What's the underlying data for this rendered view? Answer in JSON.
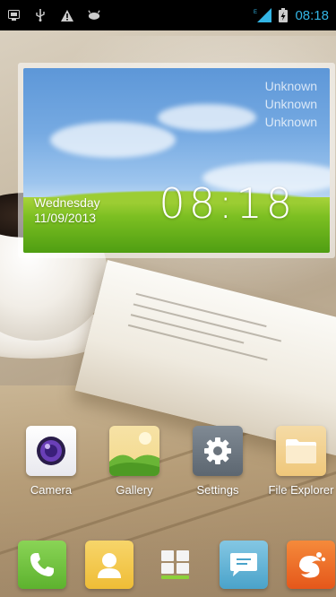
{
  "status_bar": {
    "left_icons": [
      "screenshot-icon",
      "usb-icon",
      "warning-icon",
      "debug-icon"
    ],
    "network_type": "E",
    "right_icons": [
      "signal-icon",
      "battery-charging-icon"
    ],
    "time": "08:18"
  },
  "widget": {
    "weather_lines": [
      "Unknown",
      "Unknown",
      "Unknown"
    ],
    "day": "Wednesday",
    "date": "11/09/2013",
    "time": "08:18"
  },
  "apps": [
    {
      "label": "Camera",
      "icon": "camera-icon"
    },
    {
      "label": "Gallery",
      "icon": "gallery-icon"
    },
    {
      "label": "Settings",
      "icon": "settings-gear-icon"
    },
    {
      "label": "File Explorer",
      "icon": "folder-icon"
    }
  ],
  "dock": [
    {
      "icon": "phone-icon"
    },
    {
      "icon": "contacts-icon"
    },
    {
      "icon": "all-apps-icon"
    },
    {
      "icon": "messaging-icon"
    },
    {
      "icon": "uc-browser-icon"
    }
  ],
  "colors": {
    "clock_accent": "#33b5e5",
    "phone_green": "#6cc63c",
    "contacts_yellow": "#f2c94c",
    "messaging_blue": "#5fb3d6",
    "uc_orange": "#f26f21"
  }
}
